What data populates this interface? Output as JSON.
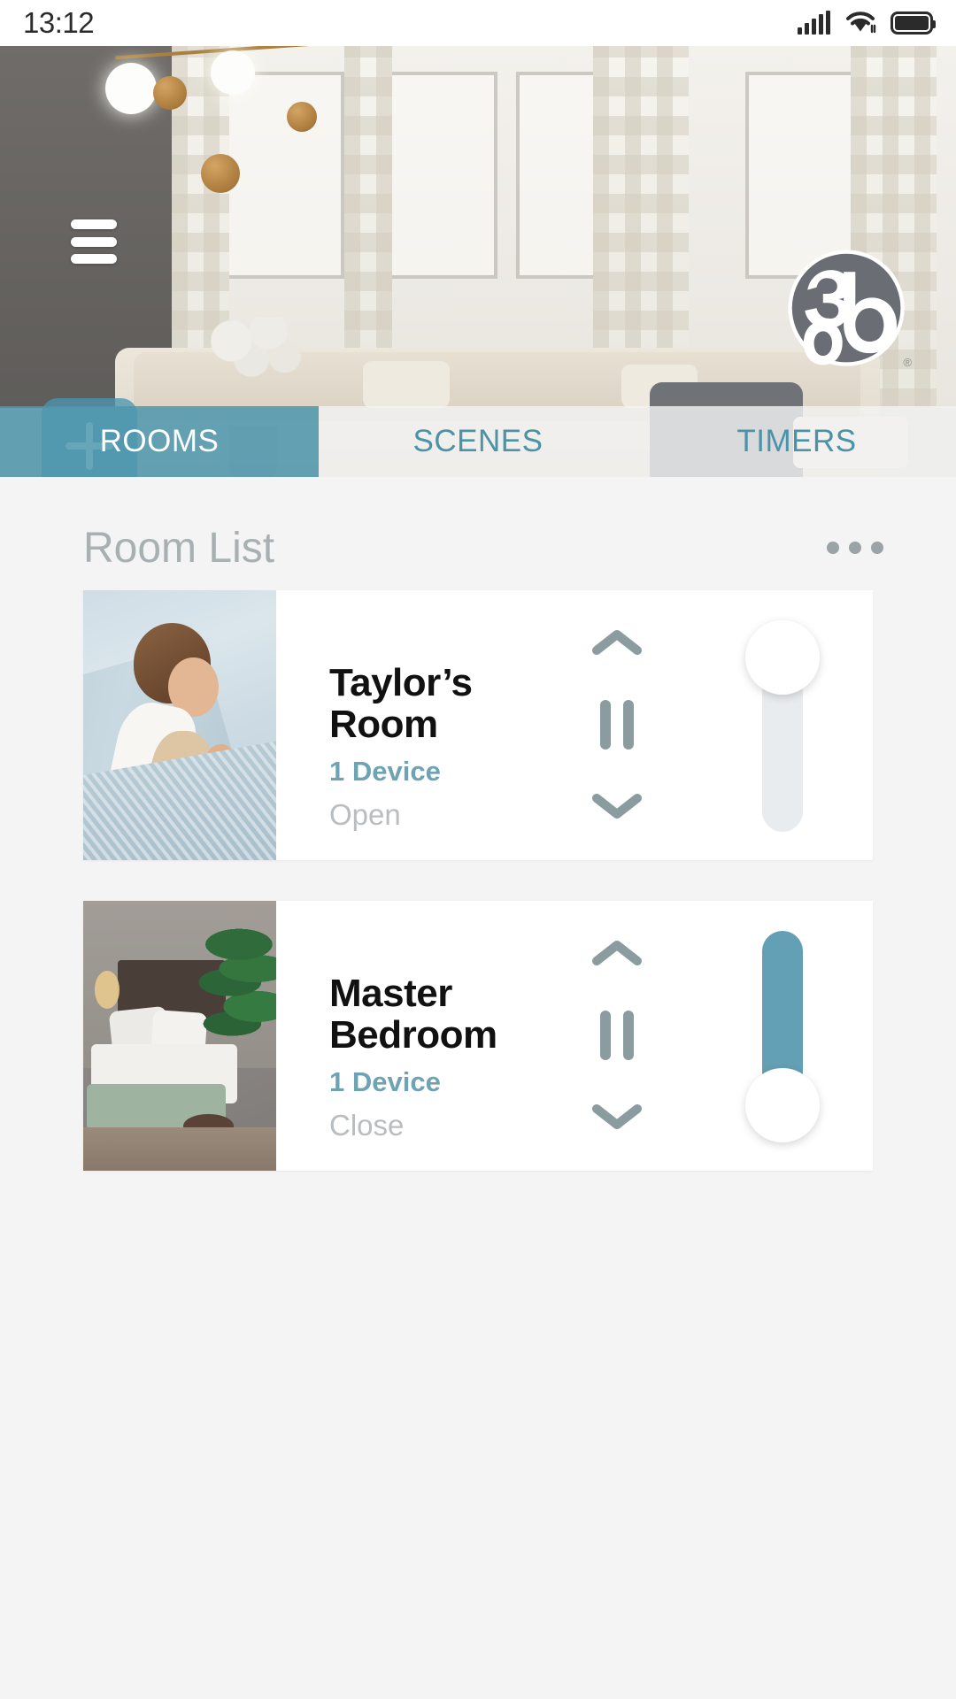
{
  "status_bar": {
    "time": "13:12",
    "icons": [
      "signal-icon",
      "wifi-icon",
      "battery-icon"
    ]
  },
  "header": {
    "menu_icon": "hamburger-menu-icon",
    "logo": "brand-logo",
    "logo_registered_mark": "®",
    "add_button_icon": "plus-icon"
  },
  "tabs": [
    {
      "label": "ROOMS",
      "active": true
    },
    {
      "label": "SCENES",
      "active": false
    },
    {
      "label": "TIMERS",
      "active": false
    }
  ],
  "main": {
    "list_title": "Room List",
    "overflow_menu_icon": "more-options-icon"
  },
  "rooms": [
    {
      "name": "Taylor’s Room",
      "devices": "1 Device",
      "state": "Open",
      "thumbnail": "child-sleeping-with-teddy-photo",
      "slider": {
        "fill_percent": 0,
        "thumb_position": "top",
        "filled": false
      },
      "controls": [
        "chevron-up-icon",
        "pause-icon",
        "chevron-down-icon"
      ]
    },
    {
      "name": "Master Bedroom",
      "devices": "1 Device",
      "state": "Close",
      "thumbnail": "master-bedroom-photo",
      "slider": {
        "fill_percent": 100,
        "thumb_position": "bottom",
        "filled": true
      },
      "controls": [
        "chevron-up-icon",
        "pause-icon",
        "chevron-down-icon"
      ]
    }
  ],
  "colors": {
    "accent_teal": "#4e96ac",
    "device_teal": "#6ea3b4",
    "chevron_gray": "#8b9ca0",
    "title_gray": "#a8b0b2",
    "state_gray": "#b9bdbf",
    "page_bg": "#f4f4f5",
    "card_bg": "#ffffff",
    "slider_track_empty": "#e8ecee",
    "slider_track_filled": "#64a0b5"
  }
}
